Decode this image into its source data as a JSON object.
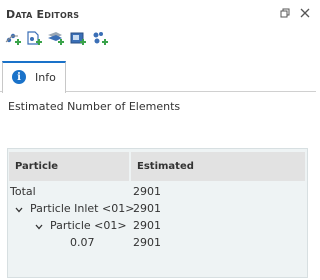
{
  "panel": {
    "title": "Data Editors"
  },
  "toolbar": {
    "buttons": [
      {
        "name": "add-particle-icon"
      },
      {
        "name": "add-document-icon"
      },
      {
        "name": "add-layer-icon"
      },
      {
        "name": "add-image-icon"
      },
      {
        "name": "add-group-icon"
      }
    ]
  },
  "tabs": [
    {
      "label": "Info",
      "icon": "info-icon",
      "active": true
    }
  ],
  "main": {
    "heading": "Estimated Number of Elements",
    "table": {
      "columns": [
        "Particle",
        "Estimated"
      ],
      "rows": [
        {
          "label": "Total",
          "value": "2901",
          "level": 0,
          "expandable": false
        },
        {
          "label": "Particle Inlet <01>",
          "value": "2901",
          "level": 1,
          "expandable": true
        },
        {
          "label": "Particle <01>",
          "value": "2901",
          "level": 2,
          "expandable": true
        },
        {
          "label": "0.07",
          "value": "2901",
          "level": 3,
          "expandable": false
        }
      ]
    }
  },
  "colors": {
    "accent": "#1a72c9",
    "icon_green": "#3aa34a",
    "table_bg": "#eef3f4",
    "header_bg": "#e2e2e2"
  }
}
